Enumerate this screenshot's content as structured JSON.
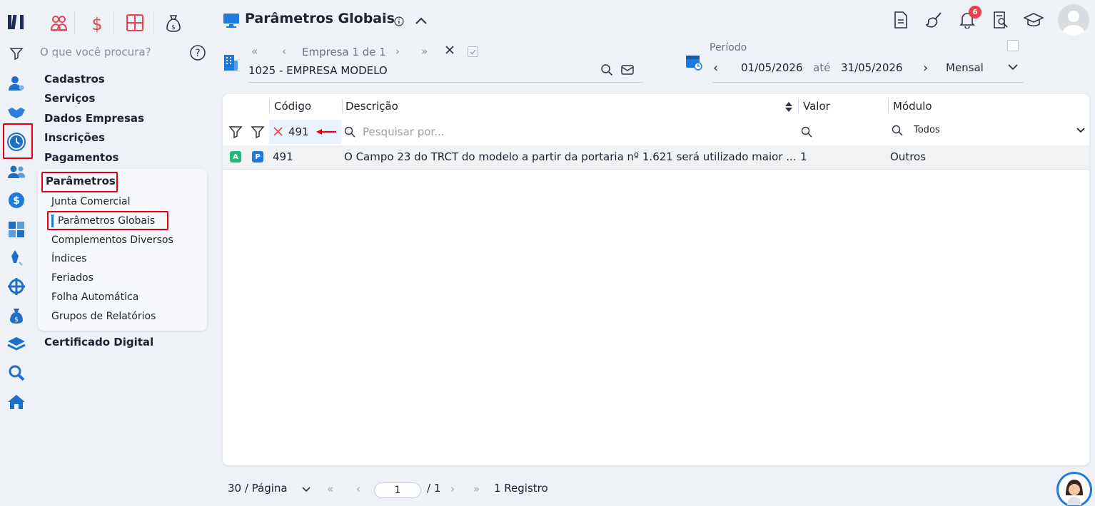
{
  "search": {
    "placeholder": "O que você procura?"
  },
  "nav": {
    "sections": [
      "Cadastros",
      "Serviços",
      "Dados Empresas",
      "Inscrições",
      "Pagamentos"
    ],
    "parametros": "Parâmetros",
    "sub_items": [
      "Junta Comercial",
      "Parâmetros Globais",
      "Complementos Diversos",
      "Índices",
      "Feriados",
      "Folha Automática",
      "Grupos de Relatórios"
    ],
    "certificado": "Certificado Digital"
  },
  "header": {
    "title": "Parâmetros Globais",
    "notification_count": "6"
  },
  "empresa": {
    "nav_label": "Empresa 1 de 1",
    "selected": "1025 - EMPRESA MODELO"
  },
  "periodo": {
    "label": "Período",
    "start": "01/05/2026",
    "until": "até",
    "end": "31/05/2026",
    "mode": "Mensal"
  },
  "table": {
    "columns": [
      "Código",
      "Descrição",
      "Valor",
      "Módulo"
    ],
    "filter_codigo": "491",
    "filter_descricao_placeholder": "Pesquisar por...",
    "filter_modulo": "Todos",
    "rows": [
      {
        "badge_a": "A",
        "badge_p": "P",
        "codigo": "491",
        "descricao": "O Campo 23 do TRCT do modelo a partir da portaria nº 1.621 será utilizado maior ...",
        "valor": "1",
        "modulo": "Outros"
      }
    ]
  },
  "pagination": {
    "per_page": "30 / Página",
    "page": "1",
    "total_pages": "/ 1",
    "records": "1 Registro"
  },
  "colors": {
    "accent": "#1f7ae0",
    "red_box": "#e0000f",
    "brand_red": "#e8424e"
  }
}
